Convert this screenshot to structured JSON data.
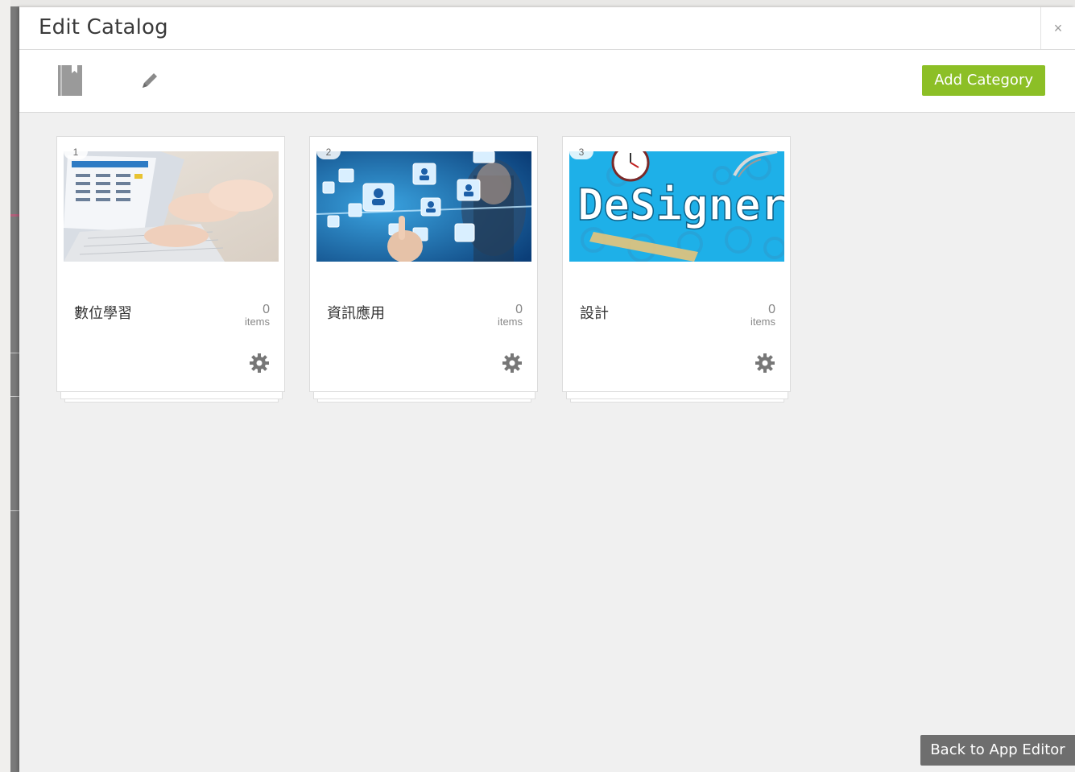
{
  "modal": {
    "title": "Edit Catalog",
    "close_label": "×"
  },
  "toolbar": {
    "add_category_label": "Add Category",
    "icons": [
      "catalog-book-icon",
      "pencil-icon"
    ]
  },
  "categories": [
    {
      "index": "1",
      "name": "數位學習",
      "count": "0",
      "count_label": "items",
      "image": "typing-laptop-photo"
    },
    {
      "index": "2",
      "name": "資訊應用",
      "count": "0",
      "count_label": "items",
      "image": "social-network-touch-photo"
    },
    {
      "index": "3",
      "name": "設計",
      "count": "0",
      "count_label": "items",
      "image": "designer-banner",
      "image_text": "DeSigner"
    }
  ],
  "footer": {
    "back_label": "Back to App Editor"
  },
  "colors": {
    "accent_green": "#8cbf26",
    "back_button": "#6e6e6e",
    "panel_bg": "#f0f0f0"
  }
}
